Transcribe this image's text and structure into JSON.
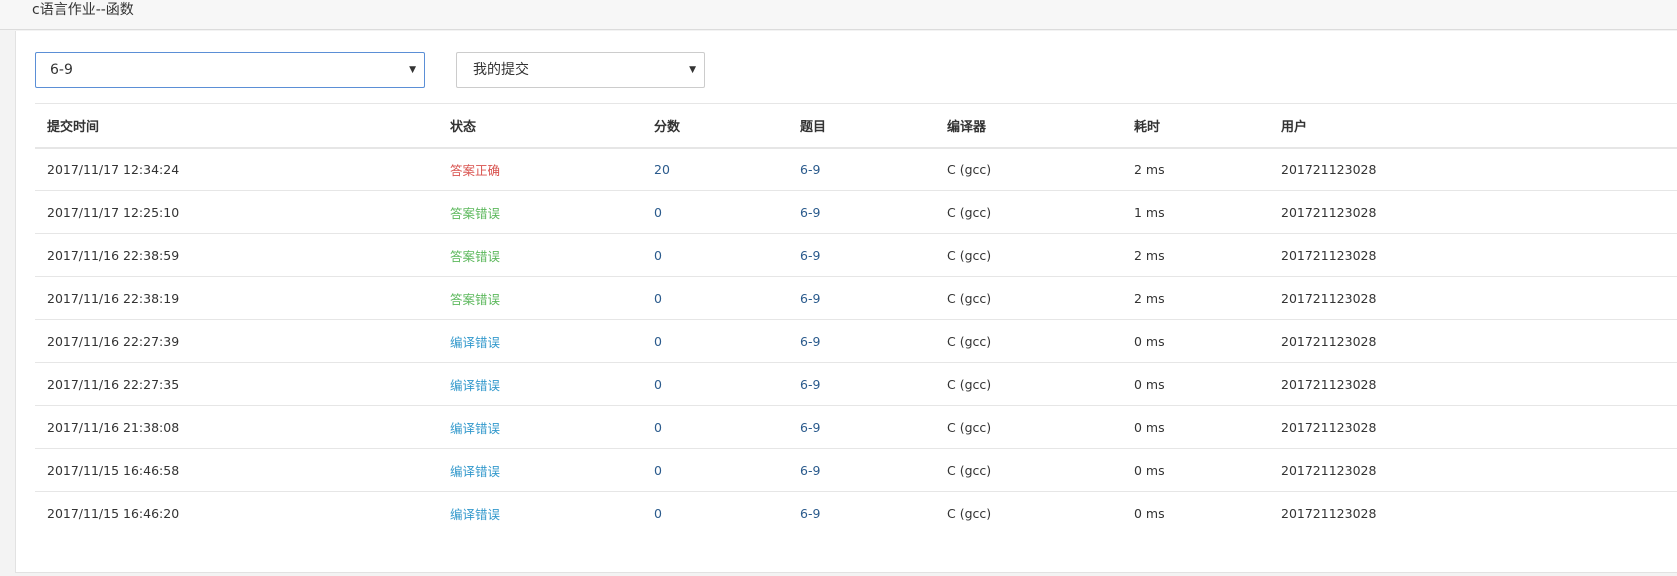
{
  "header": {
    "title": "c语言作业--函数"
  },
  "filters": {
    "problem_select": "6-9",
    "scope_select": "我的提交"
  },
  "table": {
    "columns": [
      "提交时间",
      "状态",
      "分数",
      "题目",
      "编译器",
      "耗时",
      "用户"
    ],
    "rows": [
      {
        "time": "2017/11/17 12:34:24",
        "status": "答案正确",
        "status_type": "accepted",
        "score": "20",
        "problem": "6-9",
        "compiler": "C (gcc)",
        "elapsed": "2 ms",
        "user": "201721123028"
      },
      {
        "time": "2017/11/17 12:25:10",
        "status": "答案错误",
        "status_type": "wrong",
        "score": "0",
        "problem": "6-9",
        "compiler": "C (gcc)",
        "elapsed": "1 ms",
        "user": "201721123028"
      },
      {
        "time": "2017/11/16 22:38:59",
        "status": "答案错误",
        "status_type": "wrong",
        "score": "0",
        "problem": "6-9",
        "compiler": "C (gcc)",
        "elapsed": "2 ms",
        "user": "201721123028"
      },
      {
        "time": "2017/11/16 22:38:19",
        "status": "答案错误",
        "status_type": "wrong",
        "score": "0",
        "problem": "6-9",
        "compiler": "C (gcc)",
        "elapsed": "2 ms",
        "user": "201721123028"
      },
      {
        "time": "2017/11/16 22:27:39",
        "status": "编译错误",
        "status_type": "compile",
        "score": "0",
        "problem": "6-9",
        "compiler": "C (gcc)",
        "elapsed": "0 ms",
        "user": "201721123028"
      },
      {
        "time": "2017/11/16 22:27:35",
        "status": "编译错误",
        "status_type": "compile",
        "score": "0",
        "problem": "6-9",
        "compiler": "C (gcc)",
        "elapsed": "0 ms",
        "user": "201721123028"
      },
      {
        "time": "2017/11/16 21:38:08",
        "status": "编译错误",
        "status_type": "compile",
        "score": "0",
        "problem": "6-9",
        "compiler": "C (gcc)",
        "elapsed": "0 ms",
        "user": "201721123028"
      },
      {
        "time": "2017/11/15 16:46:58",
        "status": "编译错误",
        "status_type": "compile",
        "score": "0",
        "problem": "6-9",
        "compiler": "C (gcc)",
        "elapsed": "0 ms",
        "user": "201721123028"
      },
      {
        "time": "2017/11/15 16:46:20",
        "status": "编译错误",
        "status_type": "compile",
        "score": "0",
        "problem": "6-9",
        "compiler": "C (gcc)",
        "elapsed": "0 ms",
        "user": "201721123028"
      }
    ]
  },
  "colors": {
    "accepted": "#d9534f",
    "wrong": "#5cb85c",
    "compile": "#3399cc",
    "link": "#2a5a8c",
    "select_focus_border": "#5b8fd6"
  },
  "icons": {
    "select_caret": "caret-down-icon"
  }
}
